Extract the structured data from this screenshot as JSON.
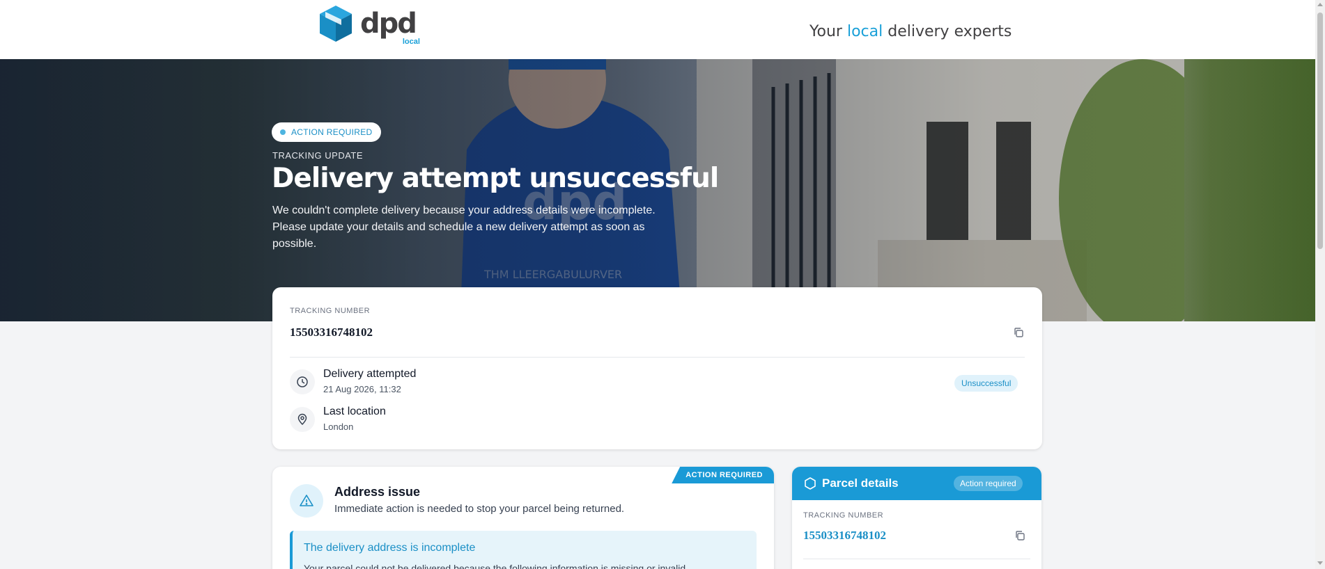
{
  "header": {
    "logo_word": "dpd",
    "logo_sub": "local",
    "tagline_pre": "Your ",
    "tagline_highlight": "local",
    "tagline_post": " delivery experts"
  },
  "hero": {
    "badge": "ACTION REQUIRED",
    "eyebrow": "TRACKING UPDATE",
    "title": "Delivery attempt unsuccessful",
    "description": "We couldn't complete delivery because your address details were incomplete. Please update your details and schedule a new delivery attempt as soon as possible."
  },
  "tracking": {
    "label": "TRACKING NUMBER",
    "number": "15503316748102",
    "event_title": "Delivery attempted",
    "event_time": "21 Aug 2026, 11:32",
    "status": "Unsuccessful",
    "location_title": "Last location",
    "location_value": "London"
  },
  "issue": {
    "corner_badge": "ACTION REQUIRED",
    "title": "Address issue",
    "subtitle": "Immediate action is needed to stop your parcel being returned.",
    "alert_title": "The delivery address is incomplete",
    "alert_text": "Your parcel could not be delivered because the following information is missing or invalid"
  },
  "parcel": {
    "title": "Parcel details",
    "status": "Action required",
    "label": "TRACKING NUMBER",
    "number": "15503316748102"
  },
  "colors": {
    "brand_blue": "#1a9ad6",
    "brand_grey": "#414042",
    "page_bg": "#f3f4f6"
  },
  "icons": {
    "copy": "copy-icon",
    "clock": "clock-icon",
    "location": "map-pin-icon",
    "warning": "warning-triangle-icon",
    "parcel": "box-hexagon-icon"
  }
}
